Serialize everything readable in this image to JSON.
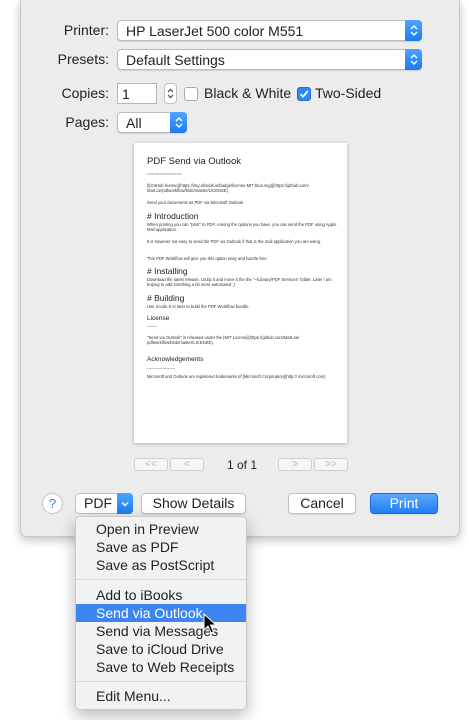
{
  "printer": {
    "label": "Printer:",
    "value": "HP LaserJet 500 color M551"
  },
  "presets": {
    "label": "Presets:",
    "value": "Default Settings"
  },
  "copies": {
    "label": "Copies:",
    "value": "1",
    "bw_label": "Black & White",
    "bw_checked": false,
    "twosided_label": "Two-Sided",
    "twosided_checked": true
  },
  "pages": {
    "label": "Pages:",
    "value": "All"
  },
  "preview": {
    "title": "PDF Send via Outlook",
    "underline": "==============",
    "license_line": "[![GitHub license](https://img.shields.io/badge/license-MIT-blue.svg)](https://github.com/ MarLoe/pdfworkflow/blob/master/LICENSE)",
    "intro_line": "Send your documents as PDF via Microsoft Outlook.",
    "h_introduction": "# Introduction",
    "p_intro1": "When printing you can \"print\" to PDF. Among the options you have, you can send the PDF using Apple Mail application.",
    "p_intro2": "It is however not easy to send the PDF via Outlook if that is the mail application you are using.",
    "p_intro3": "This PDF Workflow will give you this option easy and hazzle free.",
    "h_installing": "# Installing",
    "p_install": "Download the latest release. Unzip it and move it the the \"~/Library/PDF Services\" folder. Later I am hoping to add somthing a bit more automated ;)",
    "h_building": "# Building",
    "p_building": "Use Xcode 9 or later to build the PDF Workflow bundle.",
    "h_license": "License",
    "license_dashes": "-------",
    "p_license": "\"Send via Outlook\" is released under the [MIT License](https://github.com/MarLoe/ pdfworkflow/blob/master/LICENSE).",
    "h_ack": "Acknowledgements",
    "ack_dashes": "--------------------",
    "p_ack": "Microsoft and Outlook are registered trademarks of [Microsoft Corporation](http:// microsoft.com)"
  },
  "pager": {
    "first": "<<",
    "prev": "<",
    "count": "1 of 1",
    "next": ">",
    "last": ">>"
  },
  "buttons": {
    "help": "?",
    "pdf": "PDF",
    "show_details": "Show Details",
    "cancel": "Cancel",
    "print": "Print"
  },
  "menu": {
    "group1": [
      "Open in Preview",
      "Save as PDF",
      "Save as PostScript"
    ],
    "group2": [
      "Add to iBooks",
      "Send via Outlook",
      "Send via Messages",
      "Save to iCloud Drive",
      "Save to Web Receipts"
    ],
    "group3": [
      "Edit Menu..."
    ],
    "selected": "Send via Outlook"
  },
  "colors": {
    "accent": "#2e87f5",
    "sheet_bg": "#ececec",
    "menu_highlight": "#3d86f0"
  },
  "icons": {
    "popup": "up-down-chevron-icon",
    "checkbox": "checkmark-icon",
    "cursor": "arrow-pointer-icon"
  }
}
